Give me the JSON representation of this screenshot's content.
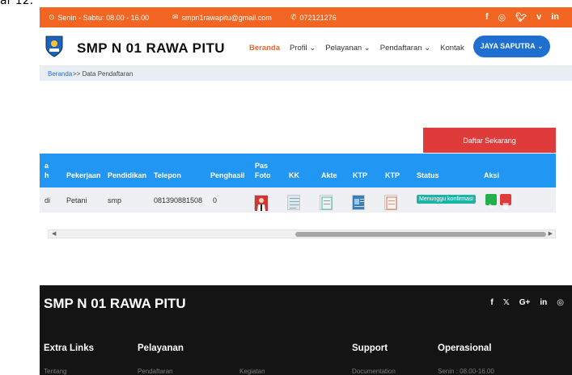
{
  "caption": "ar 12.",
  "topbar": {
    "hours": "Senin - Sabtu: 08.00 - 16.00",
    "email": "smpn1rawapitu@gmail.com",
    "phone": "072121276",
    "social_icons": [
      "facebook-icon",
      "instagram-icon",
      "twitter-icon",
      "vimeo-icon",
      "linkedin-icon"
    ]
  },
  "navbar": {
    "brand": "SMP N 01 RAWA PITU",
    "menu": [
      {
        "label": "Beranda",
        "active": true
      },
      {
        "label": "Profil ⌄",
        "active": false
      },
      {
        "label": "Pelayanan ⌄",
        "active": false
      },
      {
        "label": "Pendaftaran ⌄",
        "active": false
      },
      {
        "label": "Kontak",
        "active": false
      }
    ],
    "user_button": "JAYA SAPUTRA ⌄"
  },
  "breadcrumb": {
    "home": "Beranda",
    "current": ">> Data Pendaftaran"
  },
  "register_button": "Daftar Sekarang",
  "table": {
    "headers": {
      "partial_a": "a",
      "partial_h": "h",
      "pekerjaan": "Pekerjaan",
      "pendidikan": "Pendidikan",
      "telepon": "Telepon",
      "penghasil": "Penghasil",
      "pas": "Pas",
      "foto": "Foto",
      "kk": "KK",
      "akte": "Akte",
      "ktp1": "KTP",
      "ktp2": "KTP",
      "status": "Status",
      "aksi": "Aksi"
    },
    "row": {
      "partial": "di",
      "pekerjaan": "Petani",
      "pendidikan": "smp",
      "telepon": "081390881508",
      "penghasil": "0",
      "status": "Menunggu konfirmasi"
    }
  },
  "footer": {
    "brand": "SMP N 01 RAWA PITU",
    "social": [
      "f",
      "𝕏",
      "G+",
      "in",
      "◎"
    ],
    "columns": [
      {
        "title": "Extra Links",
        "link": "Tentang"
      },
      {
        "title": "Pelayanan",
        "link": "Pendaftaran"
      },
      {
        "title": "",
        "link": "Kegiatan"
      },
      {
        "title": "Support",
        "link": "Documentation"
      },
      {
        "title": "Operasional",
        "link": "Senin : 08.00-16.00"
      }
    ]
  },
  "colors": {
    "orange": "#f26522",
    "blue": "#2196f3",
    "red": "#e03b3b",
    "teal": "#1bb5a8",
    "green": "#22b04b"
  }
}
